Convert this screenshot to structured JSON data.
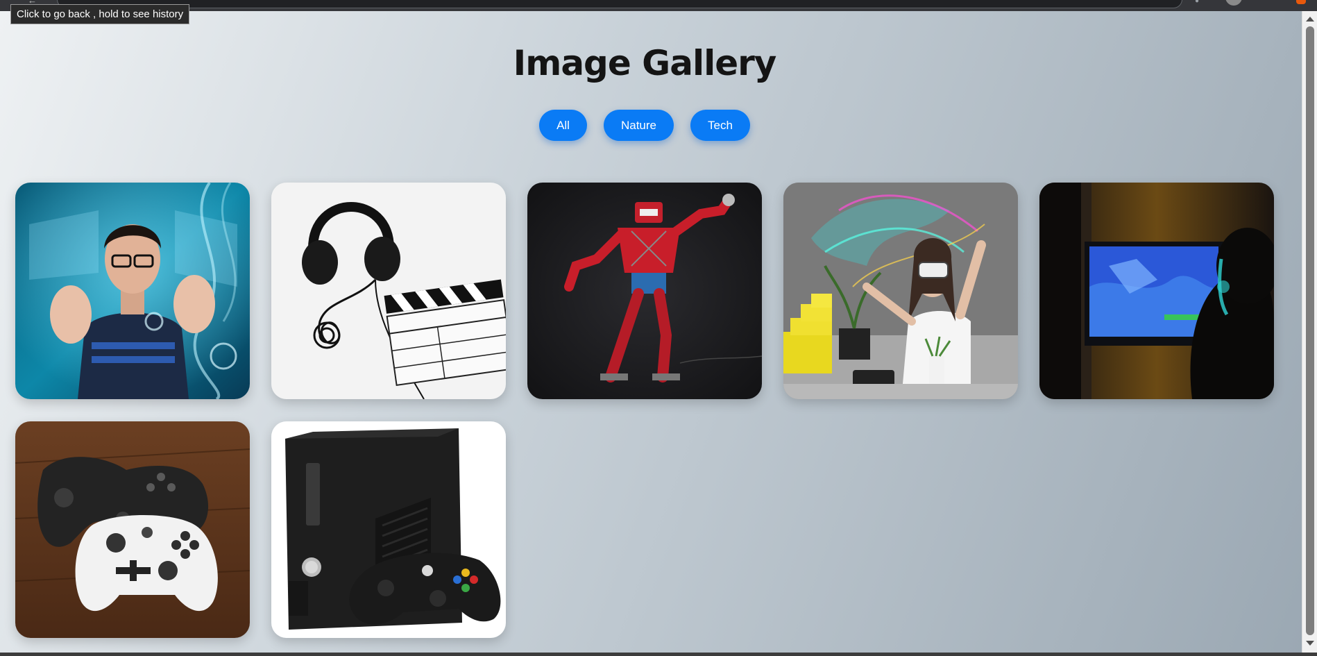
{
  "tooltip": {
    "text": "Click to go back , hold to see history"
  },
  "page": {
    "title": "Image Gallery"
  },
  "filters": [
    {
      "label": "All"
    },
    {
      "label": "Nature"
    },
    {
      "label": "Tech"
    }
  ],
  "gallery": {
    "images": [
      {
        "subject": "man-with-holographic-screens"
      },
      {
        "subject": "headphones-and-clapperboard"
      },
      {
        "subject": "red-robot"
      },
      {
        "subject": "woman-with-vr-headset"
      },
      {
        "subject": "gamer-watching-tv"
      },
      {
        "subject": "game-controllers"
      },
      {
        "subject": "xbox-360-console"
      }
    ]
  },
  "colors": {
    "accent": "#0a7bf5",
    "title": "#141414"
  },
  "icons": [
    "back-arrow-icon",
    "extension-icon",
    "profile-avatar-icon"
  ]
}
